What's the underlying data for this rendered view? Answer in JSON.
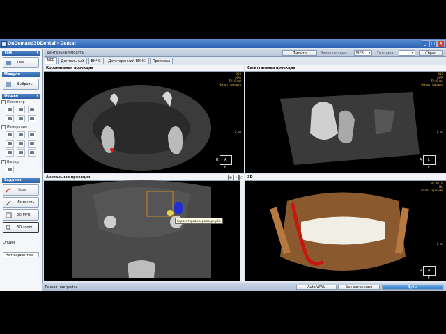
{
  "window": {
    "title": "OnDemand3DDental - Dental"
  },
  "left_panel": {
    "sections": {
      "tom": "Том",
      "modules": "Модули",
      "general": "Общие",
      "task": "Задание"
    },
    "tom_button": "Том",
    "modules_button": "Выбрать",
    "view_label": "Просмотр",
    "measure_label": "Измерение",
    "exit_label": "Выход",
    "task_buttons": [
      "Нерв",
      "Изменить",
      "3D MPR",
      "3D-zoom"
    ],
    "options_label": "Опции",
    "options_value": "Нет вариантов"
  },
  "header": {
    "module_label": "Дентальный модуль",
    "filter_button": "Фильтр",
    "visualization_label": "Визуализация:",
    "visualization_value": "MPR",
    "thickness_label": "Толщина:",
    "thickness_value": "",
    "reset_button": "Сброс"
  },
  "tabs": [
    {
      "label": "MPR",
      "active": true
    },
    {
      "label": "Дентальный",
      "active": false
    },
    {
      "label": "ВНЧС",
      "active": false
    },
    {
      "label": "Двусторонний ВНЧС",
      "active": false
    },
    {
      "label": "Проверка",
      "active": false
    }
  ],
  "viewports": {
    "coronal": {
      "title": "Корональная проекция",
      "info": [
        "359",
        "MPR",
        "TH: 0 мм",
        "Фильт. фильтр"
      ],
      "scale": "2 см",
      "orient": {
        "top": "R",
        "left": "R",
        "right": "A",
        "bottom": "F"
      }
    },
    "sagittal": {
      "title": "Сагиттальная проекция",
      "info": [
        "412",
        "MPR",
        "TH: 0 мм",
        "Фильт. фильтр"
      ],
      "scale": "2 см",
      "orient": {
        "top": "",
        "left": "A",
        "right": "L",
        "bottom": "F"
      }
    },
    "axial": {
      "title": "Аксиальная проекция",
      "tooltip": "Корректировать размер куба."
    },
    "volume": {
      "title": "3D",
      "info": [
        "RT AP LR",
        "HU",
        "Отоб. хороший"
      ],
      "scale": "2 см",
      "orient": {
        "top": "",
        "left": "R",
        "right": "A",
        "bottom": "F"
      }
    }
  },
  "status_bar": {
    "label": "Точная настройка",
    "buttons": [
      "Auto WWL",
      "Без затенения",
      "Зубы"
    ]
  },
  "colors": {
    "accent": "#2d5ea6",
    "nerve": "#c8160f",
    "cube": "#d08a2a"
  }
}
